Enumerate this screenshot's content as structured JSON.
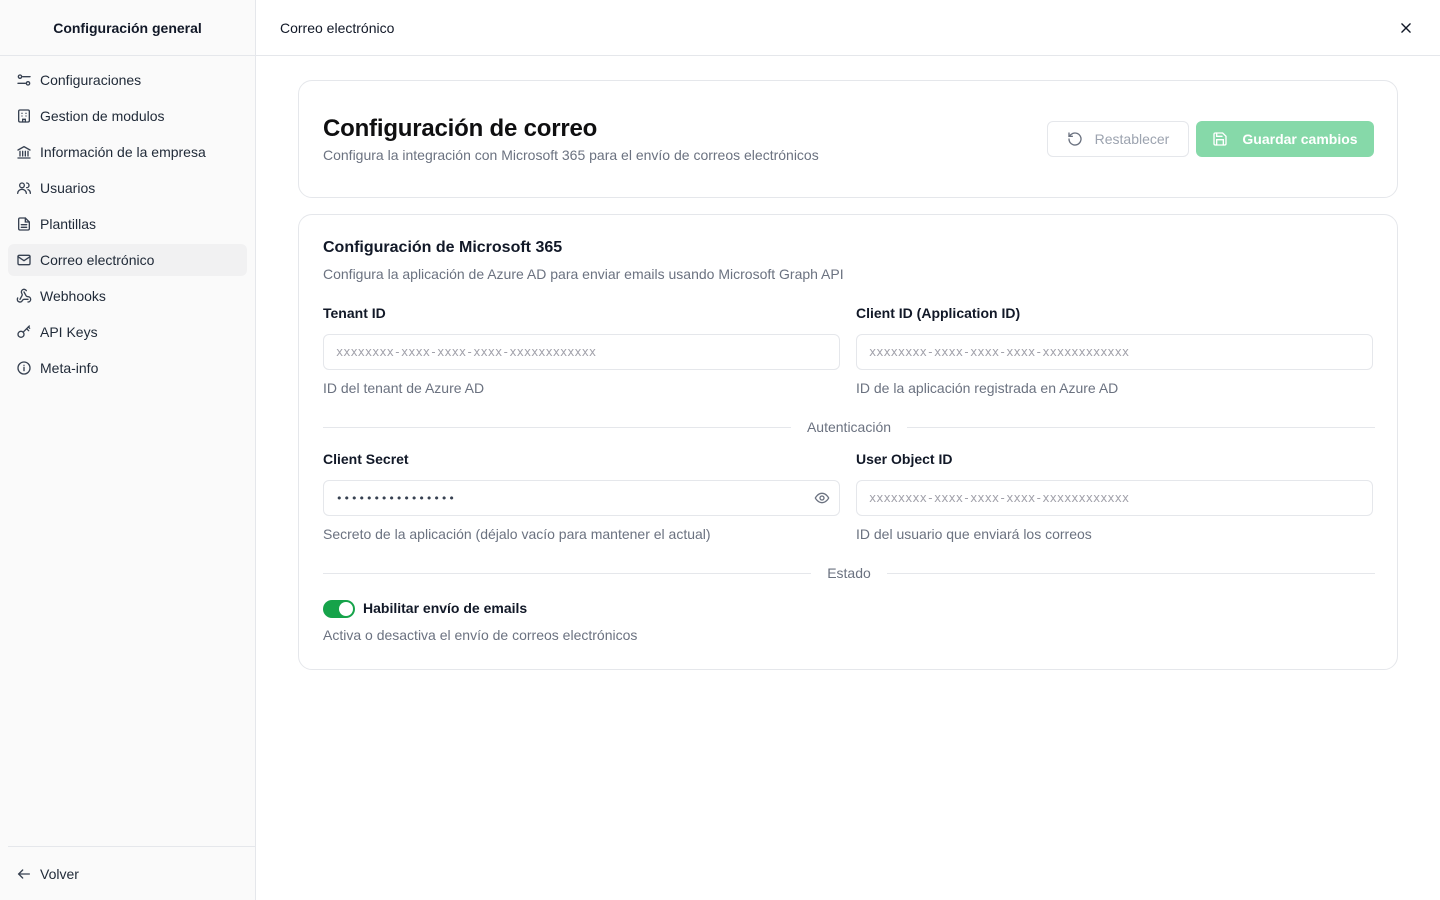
{
  "sidebar": {
    "title": "Configuración general",
    "items": [
      {
        "label": "Configuraciones",
        "icon": "sliders-icon"
      },
      {
        "label": "Gestion de modulos",
        "icon": "building-icon"
      },
      {
        "label": "Información de la empresa",
        "icon": "landmark-icon"
      },
      {
        "label": "Usuarios",
        "icon": "users-icon"
      },
      {
        "label": "Plantillas",
        "icon": "file-text-icon"
      },
      {
        "label": "Correo electrónico",
        "icon": "mail-icon",
        "active": true
      },
      {
        "label": "Webhooks",
        "icon": "webhook-icon"
      },
      {
        "label": "API Keys",
        "icon": "key-icon"
      },
      {
        "label": "Meta-info",
        "icon": "info-icon"
      }
    ],
    "back_label": "Volver"
  },
  "topbar": {
    "title": "Correo electrónico"
  },
  "header": {
    "title": "Configuración de correo",
    "subtitle": "Configura la integración con Microsoft 365 para el envío de correos electrónicos",
    "reset_label": "Restablecer",
    "save_label": "Guardar cambios"
  },
  "ms365": {
    "title": "Configuración de Microsoft 365",
    "subtitle": "Configura la aplicación de Azure AD para enviar emails usando Microsoft Graph API",
    "tenant": {
      "label": "Tenant ID",
      "placeholder": "xxxxxxxx-xxxx-xxxx-xxxx-xxxxxxxxxxxx",
      "help": "ID del tenant de Azure AD"
    },
    "client_id": {
      "label": "Client ID (Application ID)",
      "placeholder": "xxxxxxxx-xxxx-xxxx-xxxx-xxxxxxxxxxxx",
      "help": "ID de la aplicación registrada en Azure AD"
    },
    "auth_divider": "Autenticación",
    "client_secret": {
      "label": "Client Secret",
      "value": "••••••••••••••••",
      "help": "Secreto de la aplicación (déjalo vacío para mantener el actual)"
    },
    "user_object": {
      "label": "User Object ID",
      "placeholder": "xxxxxxxx-xxxx-xxxx-xxxx-xxxxxxxxxxxx",
      "help": "ID del usuario que enviará los correos"
    },
    "state_divider": "Estado",
    "toggle": {
      "label": "Habilitar envío de emails",
      "help": "Activa o desactiva el envío de correos electrónicos",
      "enabled": true
    }
  },
  "colors": {
    "accent": "#16a34a",
    "save_button": "#86d9a9"
  }
}
